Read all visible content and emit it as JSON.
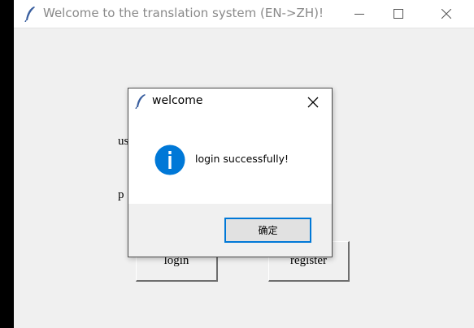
{
  "main_window": {
    "title": "Welcome to the translation system (EN->ZH)!",
    "icon": "feather-icon",
    "controls": [
      "minimize-icon",
      "maximize-icon",
      "close-icon"
    ]
  },
  "form": {
    "username_label_partial": "us",
    "password_label_partial": "p",
    "login_label": "login",
    "register_label": "register"
  },
  "dialog": {
    "title": "welcome",
    "icon": "feather-icon",
    "message": "login successfully!",
    "message_icon": "info-icon",
    "ok_label": "确定",
    "accent": "#0078d7"
  }
}
